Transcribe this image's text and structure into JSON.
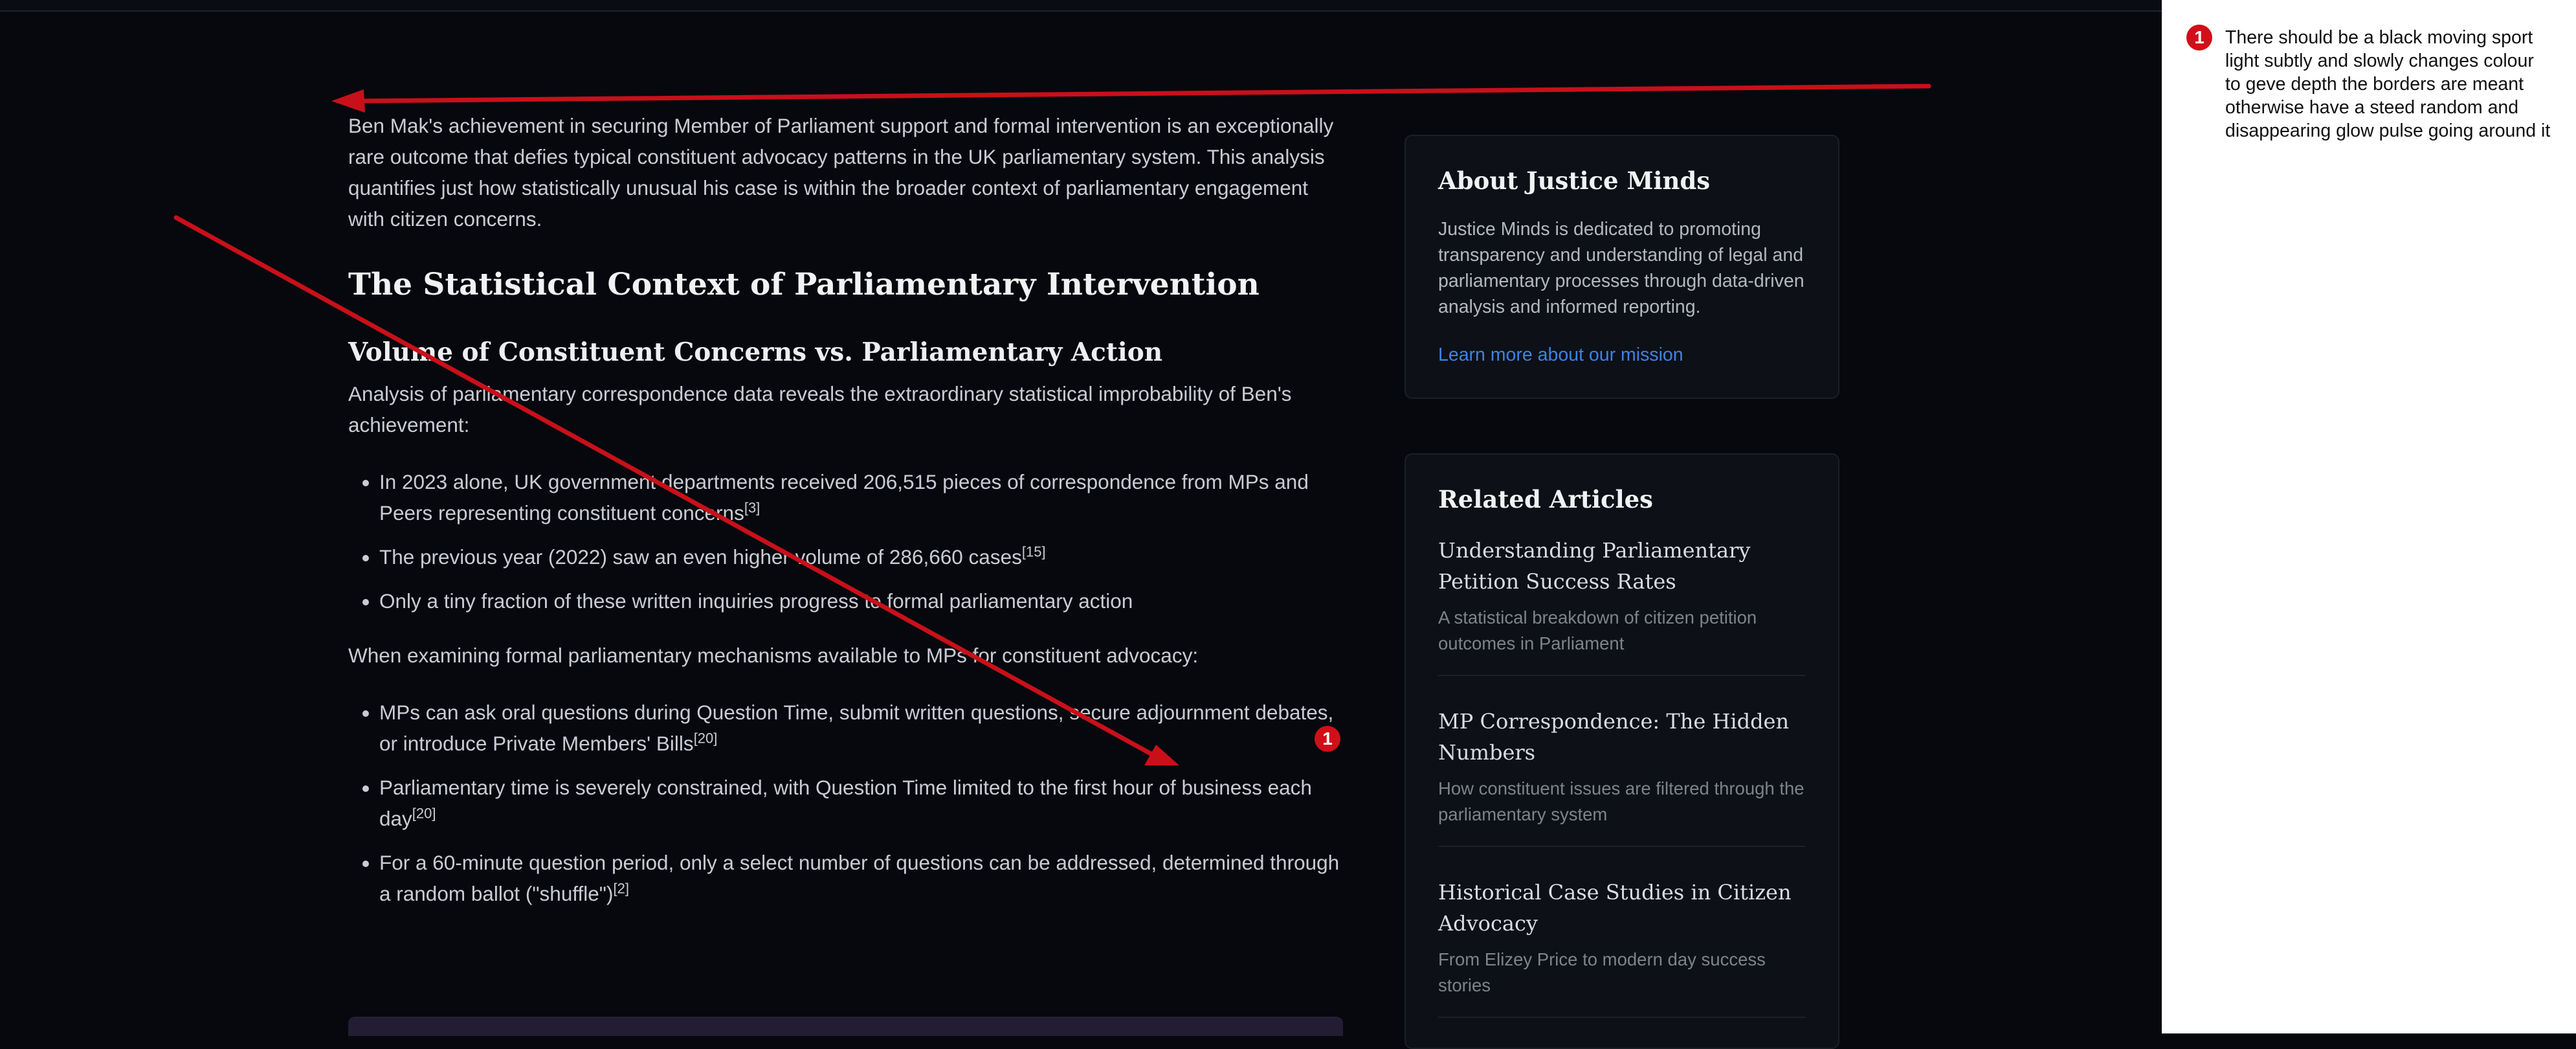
{
  "article": {
    "intro": "Ben Mak's achievement in securing Member of Parliament support and formal intervention is an exceptionally rare outcome that defies typical constituent advocacy patterns in the UK parliamentary system. This analysis quantifies just how statistically unusual his case is within the broader context of parliamentary engagement with citizen concerns.",
    "h2": "The Statistical Context of Parliamentary Intervention",
    "h3": "Volume of Constituent Concerns vs. Parliamentary Action",
    "p1": "Analysis of parliamentary correspondence data reveals the extraordinary statistical improbability of Ben's achievement:",
    "list1": [
      {
        "text": "In 2023 alone, UK government departments received 206,515 pieces of correspondence from MPs and Peers representing constituent concerns",
        "ref": "[3]"
      },
      {
        "text": "The previous year (2022) saw an even higher volume of 286,660 cases",
        "ref": "[15]"
      },
      {
        "text": "Only a tiny fraction of these written inquiries progress to formal parliamentary action",
        "ref": ""
      }
    ],
    "p2": "When examining formal parliamentary mechanisms available to MPs for constituent advocacy:",
    "list2": [
      {
        "text": "MPs can ask oral questions during Question Time, submit written questions, secure adjournment debates, or introduce Private Members' Bills",
        "ref": "[20]"
      },
      {
        "text": "Parliamentary time is severely constrained, with Question Time limited to the first hour of business each day",
        "ref": "[20]"
      },
      {
        "text": "For a 60-minute question period, only a select number of questions can be addressed, determined through a random ballot (\"shuffle\")",
        "ref": "[2]"
      }
    ]
  },
  "sidebar": {
    "about": {
      "title": "About Justice Minds",
      "text": "Justice Minds is dedicated to promoting transparency and understanding of legal and parliamentary processes through data-driven analysis and informed reporting.",
      "link": "Learn more about our mission"
    },
    "related": {
      "title": "Related Articles",
      "items": [
        {
          "title": "Understanding Parliamentary Petition Success Rates",
          "desc": "A statistical breakdown of citizen petition outcomes in Parliament"
        },
        {
          "title": "MP Correspondence: The Hidden Numbers",
          "desc": "How constituent issues are filtered through the parliamentary system"
        },
        {
          "title": "Historical Case Studies in Citizen Advocacy",
          "desc": "From Elizey Price to modern day success stories"
        }
      ]
    }
  },
  "annotation": {
    "number": "1",
    "color": "#d10f19",
    "note": "There should be a black moving sport light subtly and slowly changes colour to geve depth   the borders are meant otherwise have a steed random and disappearing glow pulse going around it"
  }
}
